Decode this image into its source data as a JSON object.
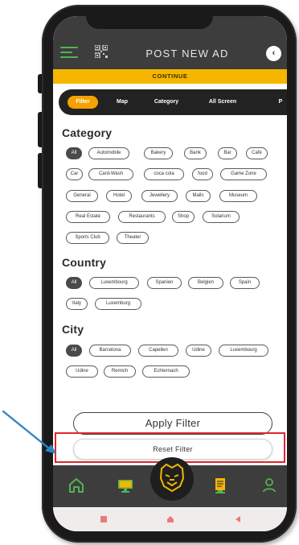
{
  "header": {
    "title": "POST NEW AD",
    "back_icon": "chevron-left-icon",
    "menu_icon": "hamburger-icon",
    "qr_icon": "qr-code-icon"
  },
  "continue_label": "CONTINUE",
  "tabs": [
    {
      "label": "Filter",
      "active": true
    },
    {
      "label": "Map",
      "active": false
    },
    {
      "label": "Category",
      "active": false
    },
    {
      "label": "All Screen",
      "active": false
    },
    {
      "label": "P",
      "active": false
    }
  ],
  "category": {
    "title": "Category",
    "chips": [
      "All",
      "Automobile",
      "Bakery",
      "Bank",
      "Bar",
      "Cafe",
      "Car",
      "Card-Wash",
      "coca cola",
      "food",
      "Game Zone",
      "General",
      "Hotel",
      "Jewellery",
      "Malls",
      "Museum",
      "Real Estate",
      "Restaurants",
      "Shop",
      "Solarium",
      "Sports Club",
      "Theater"
    ]
  },
  "country": {
    "title": "Country",
    "chips": [
      "All",
      "Luxembourg",
      "Spanien",
      "Belgien",
      "Spain",
      "Italy",
      "Luxemburg"
    ]
  },
  "city": {
    "title": "City",
    "chips": [
      "All",
      "Barcelona",
      "Capellen",
      "Udine",
      "Luxembourg",
      "Udine",
      "Remich",
      "Echternach"
    ]
  },
  "apply_label": "Apply Filter",
  "reset_label": "Reset Filter",
  "colors": {
    "accent": "#f5b600",
    "header": "#3d3d3d",
    "nav_icon": "#53b34f",
    "highlight": "#e0262b",
    "arrow": "#2e86c9"
  },
  "bottom_nav": [
    "home-icon",
    "monitor-icon",
    "bulldog-logo-icon",
    "document-icon",
    "user-icon"
  ]
}
